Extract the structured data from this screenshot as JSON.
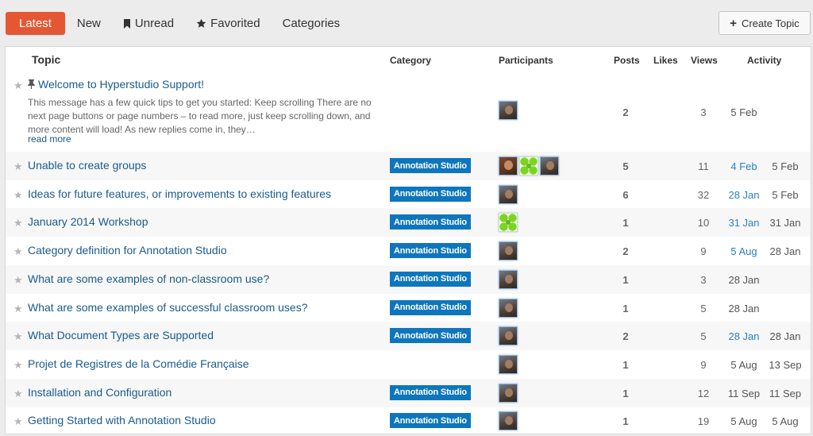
{
  "nav": {
    "latest": "Latest",
    "new": "New",
    "unread": "Unread",
    "favorited": "Favorited",
    "categories": "Categories",
    "create_topic": "Create Topic"
  },
  "columns": {
    "topic": "Topic",
    "category": "Category",
    "participants": "Participants",
    "posts": "Posts",
    "likes": "Likes",
    "views": "Views",
    "activity": "Activity"
  },
  "colors": {
    "active_tab": "#e45735",
    "category_badge": "#0e76bd",
    "link": "#1a5b8c"
  },
  "pinned_topic": {
    "title": "Welcome to Hyperstudio Support!",
    "excerpt": "This message has a few quick tips to get you started: Keep scrolling There are no next page buttons or page numbers – to read more, just keep scrolling down, and more content will load! As new replies come in, they…",
    "read_more": "read more",
    "posts": "2",
    "views": "3",
    "activity_created": "5 Feb",
    "activity_last": ""
  },
  "topics": [
    {
      "title": "Unable to create groups",
      "category": "Annotation Studio",
      "posts": "5",
      "views": "11",
      "created": "4 Feb",
      "last": "5 Feb"
    },
    {
      "title": "Ideas for future features, or improvements to existing features",
      "category": "Annotation Studio",
      "posts": "6",
      "views": "32",
      "created": "28 Jan",
      "last": "5 Feb"
    },
    {
      "title": "January 2014 Workshop",
      "category": "Annotation Studio",
      "posts": "1",
      "views": "10",
      "created": "31 Jan",
      "last": "31 Jan"
    },
    {
      "title": "Category definition for Annotation Studio",
      "category": "Annotation Studio",
      "posts": "2",
      "views": "9",
      "created": "5 Aug",
      "last": "28 Jan"
    },
    {
      "title": "What are some examples of non-classroom use?",
      "category": "Annotation Studio",
      "posts": "1",
      "views": "3",
      "created": "28 Jan",
      "last": ""
    },
    {
      "title": "What are some examples of successful classroom uses?",
      "category": "Annotation Studio",
      "posts": "1",
      "views": "5",
      "created": "28 Jan",
      "last": ""
    },
    {
      "title": "What Document Types are Supported",
      "category": "Annotation Studio",
      "posts": "2",
      "views": "5",
      "created": "28 Jan",
      "last": "28 Jan"
    },
    {
      "title": "Projet de Registres de la Comédie Française",
      "category": "",
      "posts": "1",
      "views": "9",
      "created": "5 Aug",
      "last": "13 Sep"
    },
    {
      "title": "Installation and Configuration",
      "category": "Annotation Studio",
      "posts": "1",
      "views": "12",
      "created": "11 Sep",
      "last": "11 Sep"
    },
    {
      "title": "Getting Started with Annotation Studio",
      "category": "Annotation Studio",
      "posts": "1",
      "views": "19",
      "created": "5 Aug",
      "last": "5 Aug"
    }
  ]
}
